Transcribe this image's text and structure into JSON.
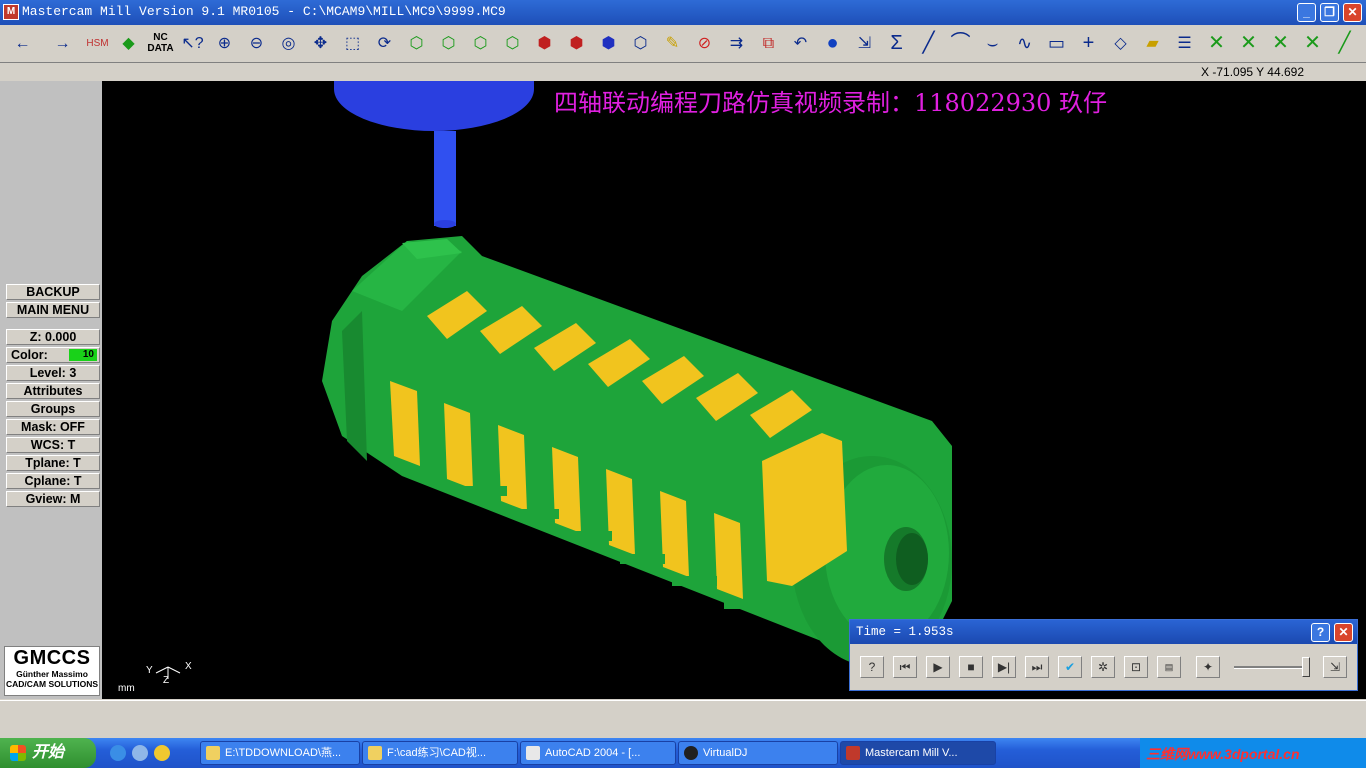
{
  "window": {
    "title": "Mastercam Mill Version 9.1 MR0105 - C:\\MCAM9\\MILL\\MC9\\9999.MC9",
    "app_icon": "mastercam-icon"
  },
  "toolbar": {
    "icons": [
      "back-arrow-icon",
      "forward-arrow-icon",
      "hsm-icon",
      "toolpath-module-icon",
      "nc-data-icon",
      "help-query-icon",
      "zoom-window-icon",
      "zoom-in-icon",
      "zoom-extents-icon",
      "pan-icon",
      "select-icon",
      "rotate-view-icon",
      "cube-view-icon",
      "cube-iso-icon",
      "cube-front-icon",
      "cube-side-icon",
      "solid-cube-icon",
      "solid-cube2-icon",
      "solid-cube3-icon",
      "3d-cube-icon",
      "pencil-icon",
      "no-entry-icon",
      "transform-icon",
      "transform2-icon",
      "undo-icon",
      "sphere-icon",
      "translate-icon",
      "sigma-icon",
      "line-icon",
      "arc-icon",
      "fillet-icon",
      "spline-icon",
      "rectangle-icon",
      "point-icon",
      "plane-icon",
      "box-icon",
      "layers-icon",
      "x-icon",
      "v-icon",
      "x2-icon",
      "x3-icon",
      "angle-line-icon"
    ],
    "nc_data_label": "NC DATA",
    "hsm_label": "HSM"
  },
  "coords": {
    "text": "X -71.095  Y 44.692"
  },
  "left_panel": {
    "backup": "BACKUP",
    "main_menu": "MAIN MENU",
    "z": "Z:  0.000",
    "color_label": "Color:",
    "color_value": "10",
    "level": "Level:  3",
    "attributes": "Attributes",
    "groups": "Groups",
    "mask": "Mask:  OFF",
    "wcs": "WCS:   T",
    "tplane": "Tplane:  T",
    "cplane": "Cplane:  T",
    "gview": "Gview:   M",
    "logo_big": "GMCCS",
    "logo_line1": "Günther Massimo",
    "logo_line2": "CAD/CAM SOLUTIONS"
  },
  "viewport": {
    "banner": "四轴联动编程刀路仿真视频录制：118022930 玖仔",
    "axis_y": "Y",
    "axis_x": "X",
    "axis_z": "Z",
    "units": "mm"
  },
  "sim_dialog": {
    "time_text": "Time = 1.953s",
    "help": "?",
    "close": "✕",
    "buttons": [
      "help-sim-icon",
      "rewind-icon",
      "play-icon",
      "stop-icon",
      "step-icon",
      "fast-forward-icon",
      "verify-icon",
      "settings-icon",
      "zoom-icon",
      "tool-info-icon",
      "run-icon",
      "exit-icon"
    ]
  },
  "taskbar": {
    "start": "开始",
    "tasks": [
      {
        "label": "E:\\TDDOWNLOAD\\燕...",
        "icon": "folder-icon"
      },
      {
        "label": "F:\\cad练习\\CAD视...",
        "icon": "folder-icon"
      },
      {
        "label": "AutoCAD 2004 - [...",
        "icon": "autocad-icon"
      },
      {
        "label": "VirtualDJ",
        "icon": "virtualdj-icon"
      },
      {
        "label": "Mastercam Mill V...",
        "icon": "mastercam-icon"
      }
    ],
    "watermark": "三维网www.3dportal.cn"
  }
}
